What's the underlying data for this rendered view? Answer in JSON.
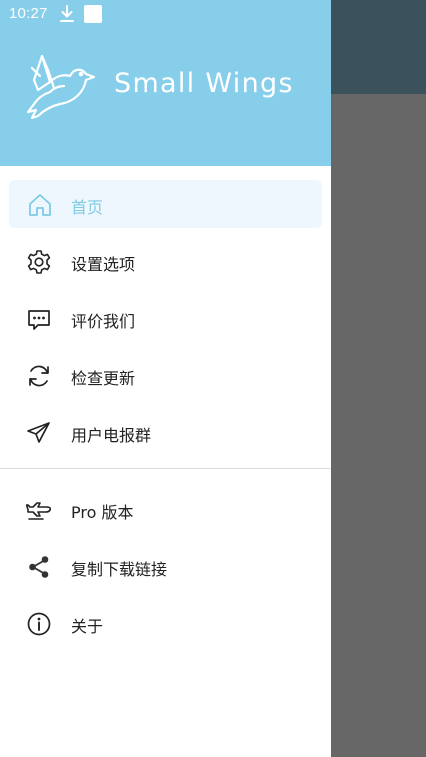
{
  "status_bar": {
    "time": "10:27",
    "icons": [
      "download-icon",
      "notification-square-icon"
    ]
  },
  "brand": {
    "name": "Small Wings",
    "logo": "dove-icon"
  },
  "colors": {
    "header_bg": "#87ceeb",
    "active_text": "#7ecbe3",
    "active_bg": "#eef7fd",
    "scrim": "#676767",
    "app_bar": "#3b525d"
  },
  "menu": {
    "primary": [
      {
        "label": "首页",
        "icon": "home-icon",
        "active": true
      },
      {
        "label": "设置选项",
        "icon": "gear-icon"
      },
      {
        "label": "评价我们",
        "icon": "chat-bubble-icon"
      },
      {
        "label": "检查更新",
        "icon": "refresh-icon"
      },
      {
        "label": "用户电报群",
        "icon": "telegram-icon"
      }
    ],
    "secondary": [
      {
        "label": "Pro 版本",
        "icon": "airplane-icon"
      },
      {
        "label": "复制下载链接",
        "icon": "share-icon"
      },
      {
        "label": "关于",
        "icon": "info-icon"
      }
    ]
  }
}
